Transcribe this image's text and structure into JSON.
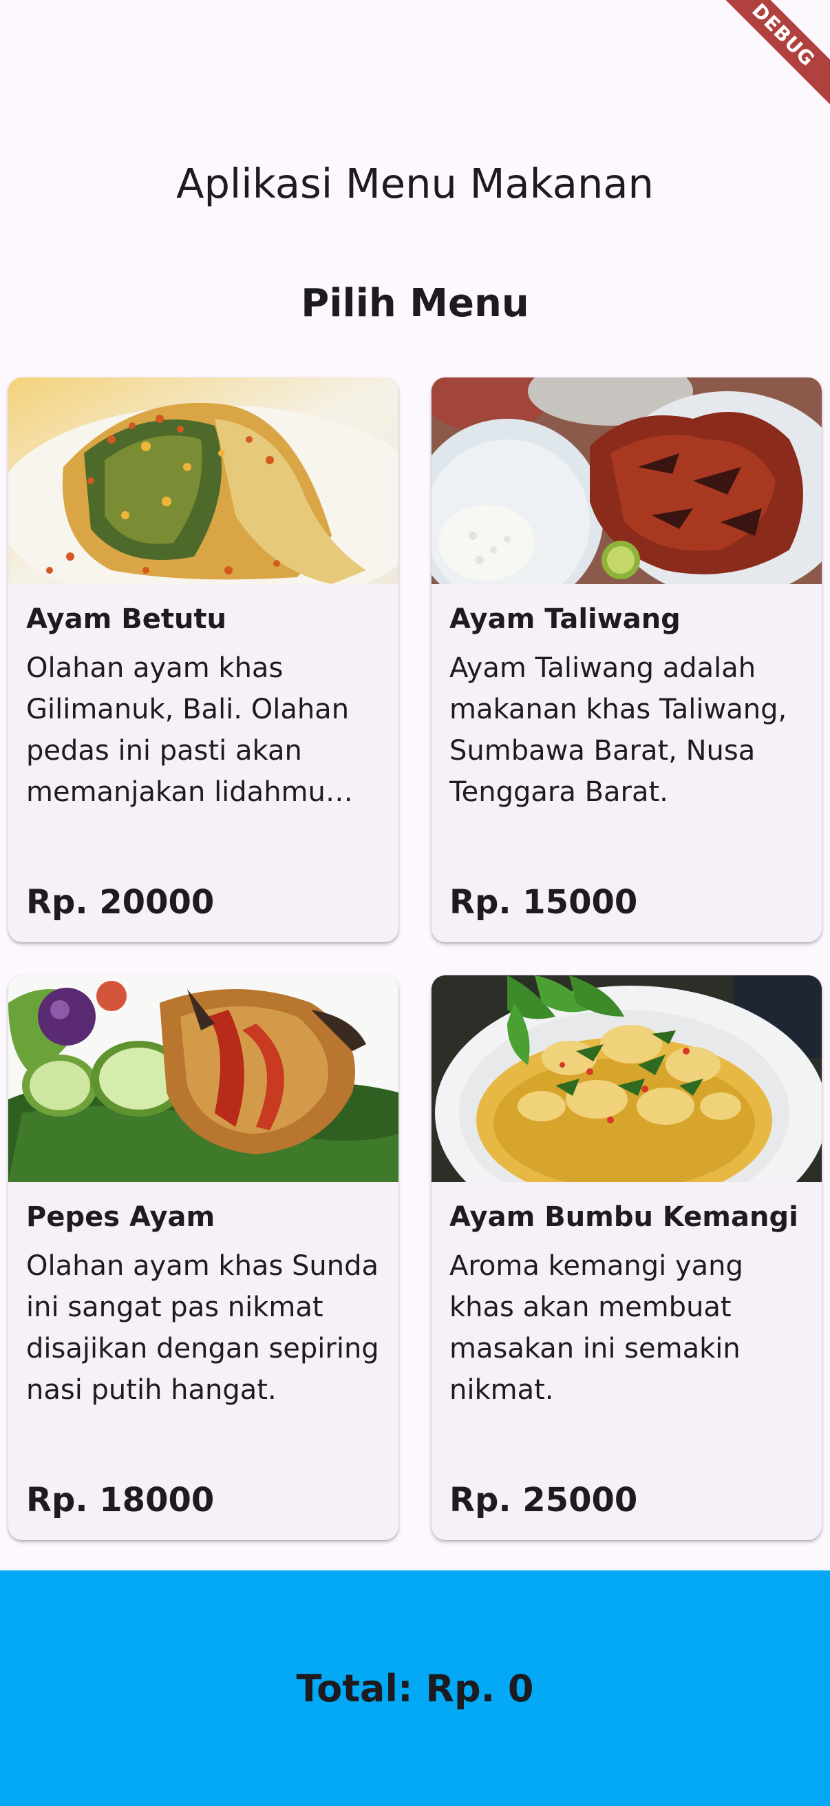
{
  "debug_banner": "DEBUG",
  "app_title": "Aplikasi Menu Makanan",
  "section_title": "Pilih Menu",
  "menu": [
    {
      "name": "Ayam Betutu",
      "description": "Olahan ayam khas Gilimanuk, Bali. Olahan pedas ini pasti akan memanjakan lidahmu dengan cita rasanya.",
      "price": "Rp. 20000"
    },
    {
      "name": "Ayam Taliwang",
      "description": "Ayam Taliwang adalah makanan khas Taliwang, Sumbawa Barat, Nusa Tenggara Barat.",
      "price": "Rp. 15000"
    },
    {
      "name": "Pepes Ayam",
      "description": "Olahan ayam khas Sunda ini sangat pas nikmat disajikan dengan sepiring nasi putih hangat.",
      "price": "Rp. 18000"
    },
    {
      "name": "Ayam Bumbu Kemangi",
      "description": "Aroma kemangi yang khas akan membuat masakan ini semakin nikmat.",
      "price": "Rp. 25000"
    }
  ],
  "footer": {
    "total": "Total: Rp. 0",
    "background": "#03a9f4"
  }
}
